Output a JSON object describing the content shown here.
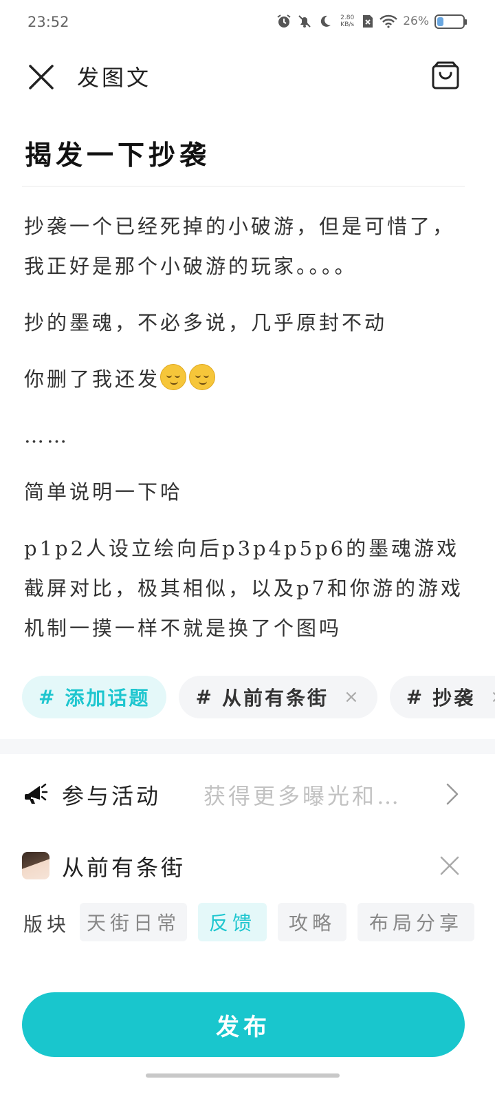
{
  "status_bar": {
    "time": "23:52",
    "net_speed_value": "2.80",
    "net_speed_unit": "KB/s",
    "battery_percent": "26%",
    "battery_level": 0.26,
    "icons": [
      "alarm-icon",
      "mute-icon",
      "do-not-disturb-icon",
      "sim-off-icon",
      "wifi-icon",
      "battery-icon"
    ]
  },
  "header": {
    "title": "发图文",
    "close_icon": "close-icon",
    "drafts_icon": "drafts-box-icon"
  },
  "post": {
    "title": "揭发一下抄袭",
    "paragraphs": [
      "抄袭一个已经死掉的小破游，但是可惜了，我正好是那个小破游的玩家。。。。",
      "抄的墨魂，不必多说，几乎原封不动",
      "你删了我还发",
      "……",
      "简单说明一下哈",
      "p1p2人设立绘向后p3p4p5p6的墨魂游戏截屏对比，极其相似，以及p7和你游的游戏机制一摸一样不就是换了个图吗"
    ],
    "emoji_count": 2
  },
  "topics": {
    "add_label": "添加话题",
    "items": [
      "从前有条街",
      "抄袭"
    ]
  },
  "activity": {
    "label": "参与活动",
    "hint": "获得更多曝光和…",
    "icon": "megaphone-icon"
  },
  "circle": {
    "name": "从前有条街"
  },
  "board": {
    "label": "版块",
    "options": [
      "天街日常",
      "反馈",
      "攻略",
      "布局分享"
    ],
    "selected": "反馈"
  },
  "publish_label": "发布",
  "colors": {
    "accent": "#19c6cd",
    "accent_light": "#e4f8f9",
    "chip_bg": "#f4f5f7",
    "hint_text": "#c2c2c2"
  }
}
